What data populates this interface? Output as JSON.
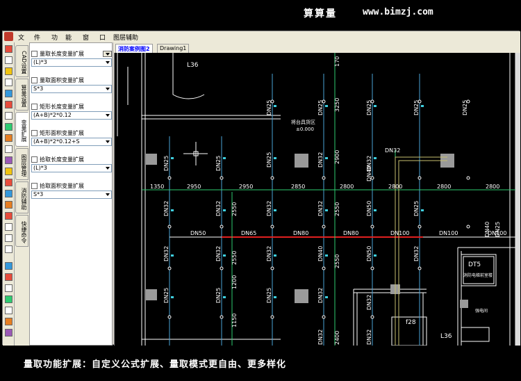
{
  "banner": {
    "brand": "算算量",
    "url": "www.bimzj.com"
  },
  "menu": [
    "文",
    "件",
    "功",
    "能",
    "窗",
    "口",
    "图层辅助"
  ],
  "vtabs": [
    "CAD设置",
    "算量设置",
    "变量扩展",
    "图层管理",
    "消防辅助",
    "快捷命令"
  ],
  "panel": {
    "items": [
      {
        "label": "量取长度变量扩展",
        "value": "(L)*3"
      },
      {
        "label": "量取面积变量扩展",
        "value": "S*3"
      },
      {
        "label": "矩形长度变量扩展",
        "value": "(A+B)*2*0.12"
      },
      {
        "label": "矩形面积变量扩展",
        "value": "(A+B)*2*0.12+S"
      },
      {
        "label": "拾取长度变量扩展",
        "value": "(L)*3"
      },
      {
        "label": "拾取面积变量扩展",
        "value": "S*3"
      }
    ]
  },
  "doc_tabs": [
    "消防案例图2",
    "Drawing1"
  ],
  "drawing": {
    "dims_top": [
      "1350",
      "2950",
      "2950",
      "2850",
      "2800",
      "2800",
      "2800",
      "2800"
    ],
    "pipe_labels": [
      "DN50",
      "DN65",
      "DN80",
      "DN80",
      "DN100",
      "DN100",
      "DN100"
    ],
    "dn25": "DN25",
    "dn32": "DN32",
    "dn40": "DN40",
    "dn50": "DN50",
    "vert_dims": [
      "3250",
      "2900",
      "2550",
      "2550",
      "1200",
      "1150",
      "2400",
      "170"
    ],
    "room_label": "将台具货区",
    "room_level": "±0.000",
    "room2": "消防电梯前室楼",
    "room2_code": "DT5",
    "room3": "强电间",
    "stair1": "L36",
    "stair2": "f28",
    "stair3": "L36"
  },
  "caption": "量取功能扩展：自定义公式扩展、量取模式更自由、更多样化"
}
